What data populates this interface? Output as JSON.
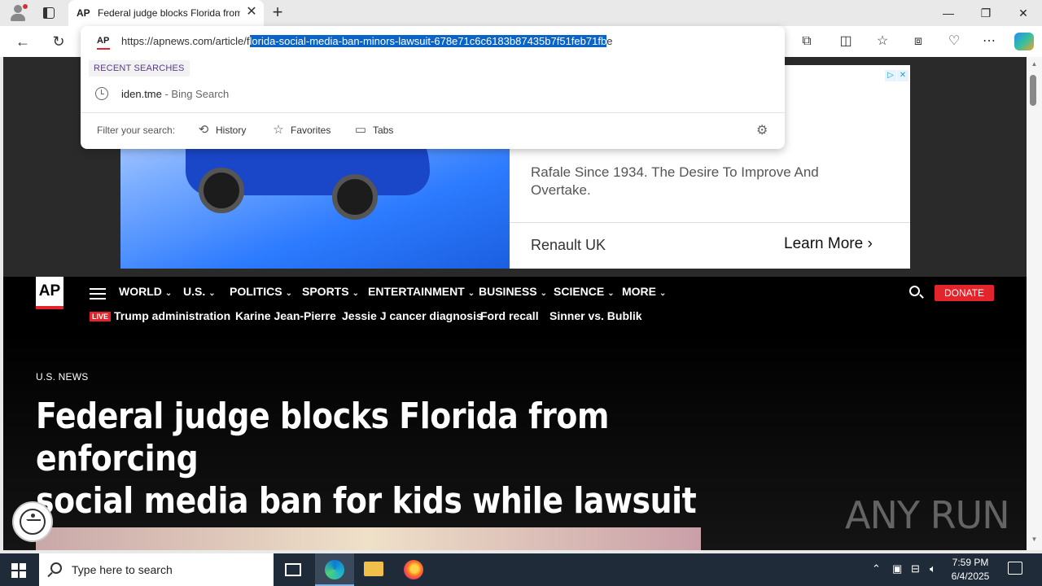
{
  "browser": {
    "tab_favicon": "AP",
    "tab_title": "Federal judge blocks Florida from enforcing social media ban for kids while lawsuit continues",
    "omnibox": {
      "favicon": "AP",
      "url_prefix": "https://apnews.com/article/f",
      "url_selected": "lorida-social-media-ban-minors-lawsuit-678e71c6c6183b87435b7f51feb71fb",
      "url_suffix": "e",
      "recent_label": "RECENT SEARCHES",
      "recent_query": "iden.tme",
      "recent_source": " - Bing Search",
      "filter_label": "Filter your search:",
      "filter_history": "History",
      "filter_favorites": "Favorites",
      "filter_tabs": "Tabs"
    }
  },
  "ad": {
    "text": "Rafale Since 1934. The Desire To Improve And Overtake.",
    "brand": "Renault UK",
    "cta": "Learn More",
    "choice_icons": [
      "ad-choices-icon",
      "close-icon"
    ]
  },
  "site": {
    "logo": "AP",
    "nav": [
      "WORLD",
      "U.S.",
      "POLITICS",
      "SPORTS",
      "ENTERTAINMENT",
      "BUSINESS",
      "SCIENCE",
      "MORE"
    ],
    "donate": "DONATE",
    "live_badge": "LIVE",
    "trending": [
      "Trump administration",
      "Karine Jean-Pierre",
      "Jessie J cancer diagnosis",
      "Ford recall",
      "Sinner vs. Bublik"
    ]
  },
  "article": {
    "kicker": "U.S. NEWS",
    "headline_line1": "Federal judge blocks Florida from enforcing",
    "headline_line2": "social media ban for kids while lawsuit continues"
  },
  "watermark": "ANY RUN",
  "taskbar": {
    "search_placeholder": "Type here to search",
    "time": "7:59 PM",
    "date": "6/4/2025"
  },
  "colors": {
    "ap_red": "#e3242b",
    "selection_blue": "#0a64c8",
    "taskbar": "#1f2b38"
  }
}
